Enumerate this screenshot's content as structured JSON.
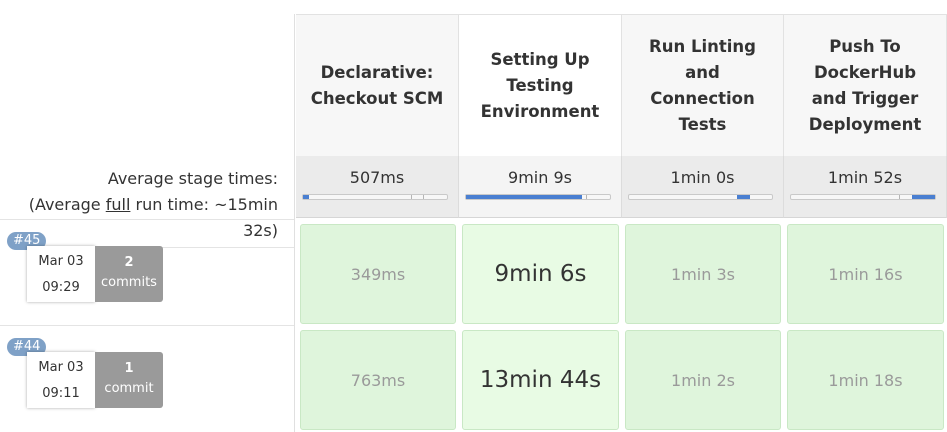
{
  "stages": [
    {
      "label": "Declarative: Checkout SCM",
      "avg_time": "507ms",
      "avg_fraction": 0.04
    },
    {
      "label": "Setting Up Testing Environment",
      "avg_time": "9min 9s",
      "avg_fraction": 0.8
    },
    {
      "label": "Run Linting and Connection Tests",
      "avg_time": "1min 0s",
      "avg_fraction": 0.09
    },
    {
      "label": "Push To DockerHub and Trigger Deployment",
      "avg_time": "1min 52s",
      "avg_fraction": 0.16
    }
  ],
  "average_label": {
    "line1": "Average stage times:",
    "prefix": "(Average ",
    "link": "full",
    "suffix": " run time: ~15min",
    "line3": "32s)"
  },
  "runs": [
    {
      "id": "#45",
      "date": "Mar 03",
      "time": "09:29",
      "commits_count": "2",
      "commits_label": "commits",
      "stage_times": [
        "349ms",
        "9min 6s",
        "1min 3s",
        "1min 16s"
      ]
    },
    {
      "id": "#44",
      "date": "Mar 03",
      "time": "09:11",
      "commits_count": "1",
      "commits_label": "commit",
      "stage_times": [
        "763ms",
        "13min 44s",
        "1min 2s",
        "1min 18s"
      ]
    }
  ],
  "colors": {
    "success_cell": "#dff5dc",
    "progress_fill": "#4a7fd1",
    "run_badge": "#7fa1c7",
    "commits_box": "#9a9a9a"
  }
}
